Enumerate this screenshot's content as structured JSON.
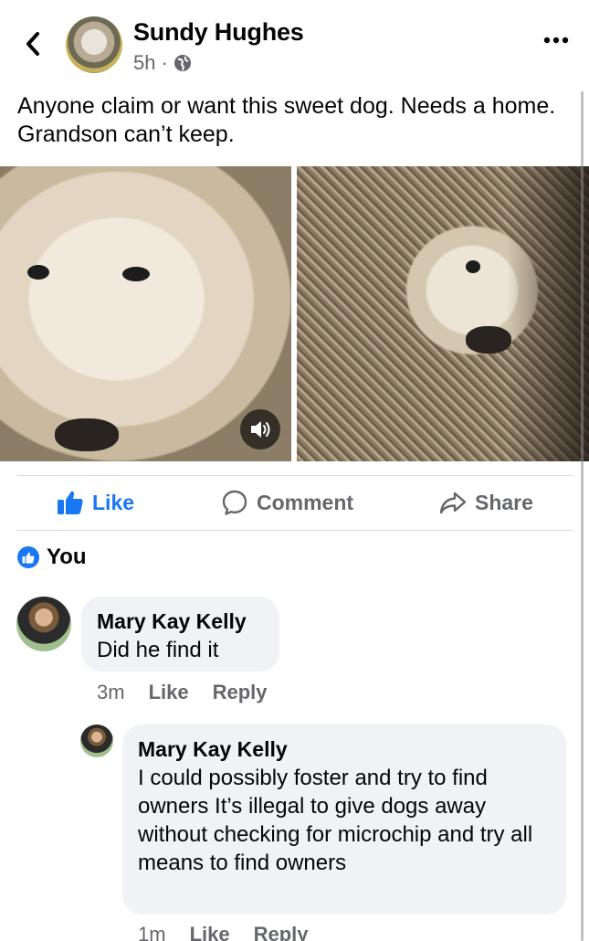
{
  "post": {
    "author": "Sundy Hughes",
    "time": "5h",
    "separator": "·",
    "privacy_icon": "globe-icon",
    "text": "Anyone claim or want this sweet dog.  Needs a home. Grandson can’t keep."
  },
  "actions": {
    "like": "Like",
    "comment": "Comment",
    "share": "Share"
  },
  "reactions": {
    "label": "You"
  },
  "comments": [
    {
      "author": "Mary Kay Kelly",
      "text": "Did he find it",
      "time": "3m",
      "like": "Like",
      "reply": "Reply"
    },
    {
      "author": "Mary Kay Kelly",
      "text": "I could possibly foster and try to find owners  It’s illegal to give dogs away without checking for microchip and try all means to find owners",
      "time": "1m",
      "like": "Like",
      "reply": "Reply"
    }
  ],
  "colors": {
    "accent": "#1877f2",
    "muted": "#65676b",
    "bubble": "#f0f2f5"
  }
}
